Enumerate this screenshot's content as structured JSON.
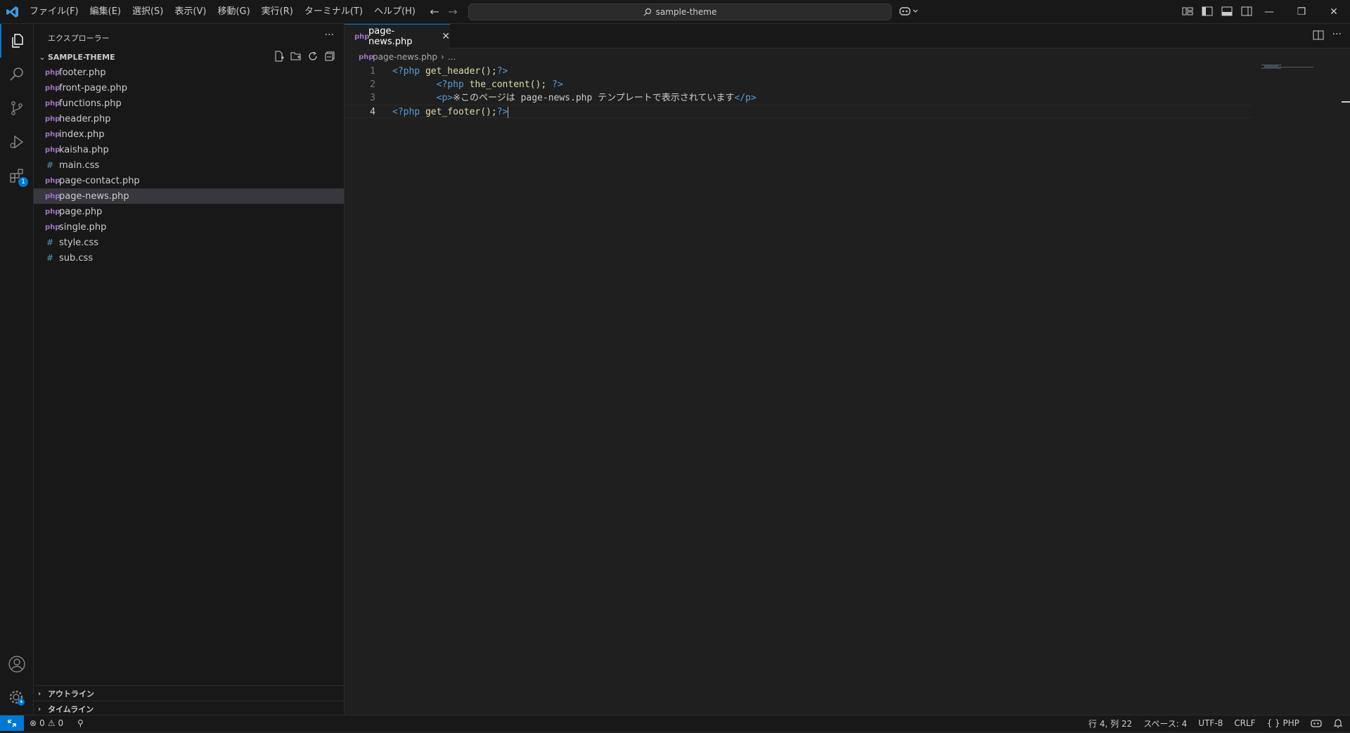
{
  "titlebar": {
    "menus": [
      "ファイル(F)",
      "編集(E)",
      "選択(S)",
      "表示(V)",
      "移動(G)",
      "実行(R)",
      "ターミナル(T)",
      "ヘルプ(H)"
    ],
    "search_text": "sample-theme"
  },
  "activitybar": {
    "items": [
      "explorer-icon",
      "search-icon",
      "source-control-icon",
      "run-debug-icon",
      "extensions-icon"
    ],
    "extensions_badge": "1",
    "bottom": [
      "account-icon",
      "manage-gear-icon"
    ]
  },
  "sidebar": {
    "title": "エクスプローラー",
    "folder": "SAMPLE-THEME",
    "files": [
      {
        "name": "footer.php",
        "type": "php"
      },
      {
        "name": "front-page.php",
        "type": "php"
      },
      {
        "name": "functions.php",
        "type": "php"
      },
      {
        "name": "header.php",
        "type": "php"
      },
      {
        "name": "index.php",
        "type": "php"
      },
      {
        "name": "kaisha.php",
        "type": "php"
      },
      {
        "name": "main.css",
        "type": "css"
      },
      {
        "name": "page-contact.php",
        "type": "php"
      },
      {
        "name": "page-news.php",
        "type": "php",
        "selected": true
      },
      {
        "name": "page.php",
        "type": "php"
      },
      {
        "name": "single.php",
        "type": "php"
      },
      {
        "name": "style.css",
        "type": "css"
      },
      {
        "name": "sub.css",
        "type": "css"
      }
    ],
    "outline_label": "アウトライン",
    "timeline_label": "タイムライン"
  },
  "editor": {
    "tab_label": "page-news.php",
    "breadcrumb_file": "page-news.php",
    "breadcrumb_more": "...",
    "line_numbers": [
      "1",
      "2",
      "3",
      "4"
    ],
    "lines": [
      {
        "indent": "",
        "open": "<?php",
        "body": " get_header();",
        "close": "?>"
      },
      {
        "indent": "        ",
        "open": "<?php",
        "body": " the_content(); ",
        "close": "?>"
      },
      {
        "indent": "        ",
        "open": "<p>",
        "body": "※このページは page-news.php テンプレートで表示されています",
        "close": "</p>"
      },
      {
        "indent": "",
        "open": "<?php",
        "body": " get_footer();",
        "close": "?>"
      }
    ]
  },
  "statusbar": {
    "errors": "0",
    "warnings": "0",
    "position": "行 4, 列 22",
    "spaces": "スペース: 4",
    "encoding": "UTF-8",
    "eol": "CRLF",
    "language": "PHP"
  },
  "colors": {
    "accent": "#0078d4",
    "php_icon": "#a074c4",
    "css_icon": "#519aba",
    "tag": "#569cd6",
    "function": "#dcdcaa"
  }
}
